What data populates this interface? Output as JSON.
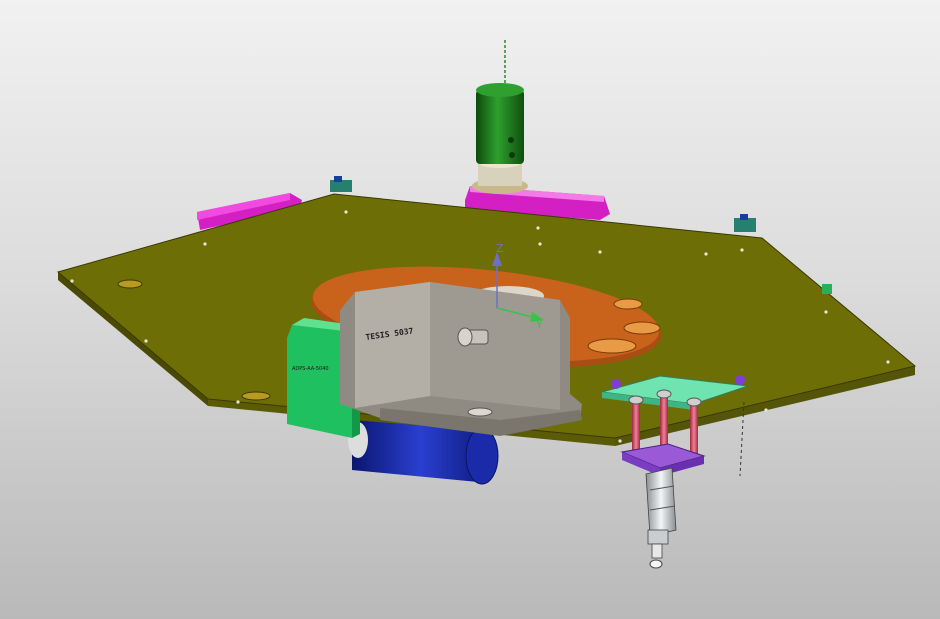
{
  "viewport": {
    "background_top": "#f1f1f1",
    "background_bottom": "#b9b9b9"
  },
  "triad": {
    "z_label": "Z",
    "y_label": "Y",
    "z_color": "#6f6fc8",
    "y_color": "#39c24a"
  },
  "parts": {
    "base_plate": {
      "color": "#6e6e07",
      "edge": "#3a3a00"
    },
    "turntable_disc": {
      "color": "#c9621b"
    },
    "gearbox_housing": {
      "color": "#8f8b82",
      "label": "TESIS 5037"
    },
    "drive_box": {
      "color": "#1fc060",
      "label": "ADPS-AA-5040"
    },
    "drive_motor": {
      "color": "#1a2aa8"
    },
    "green_motor": {
      "color": "#1d7a1d"
    },
    "magenta_brackets": {
      "color": "#e020d0"
    },
    "cyan_mount_plate": {
      "color": "#6fe3b0"
    },
    "violet_mount_plate": {
      "color": "#9a5ad8"
    },
    "guide_rods": {
      "color": "#e0607a"
    },
    "cylinder": {
      "color": "#cfd3d6"
    }
  }
}
